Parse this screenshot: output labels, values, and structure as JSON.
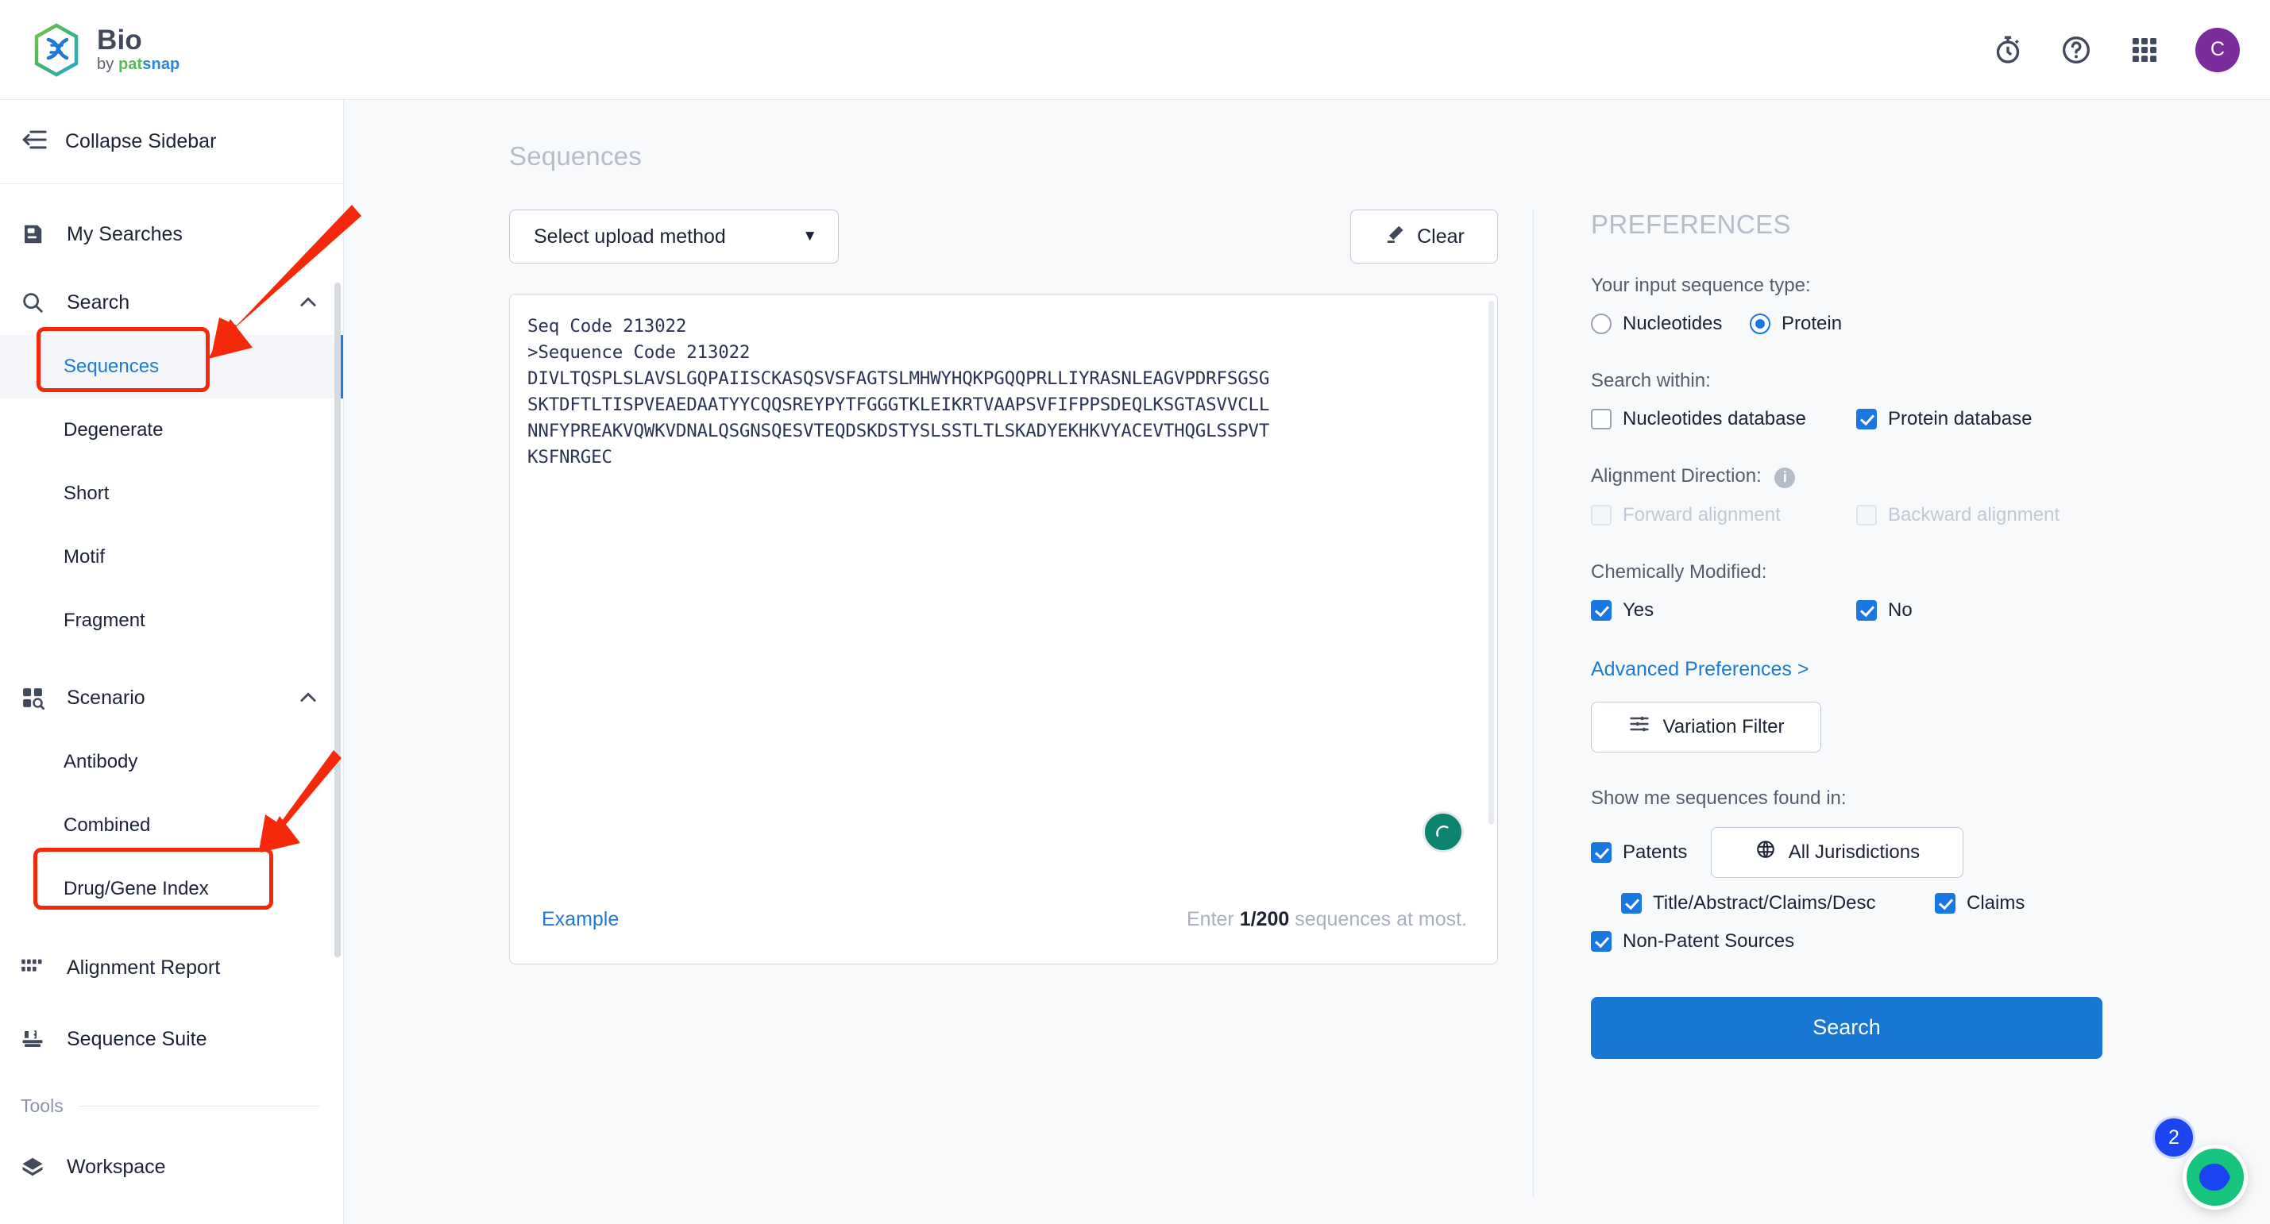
{
  "brand": {
    "title": "Bio",
    "by": "by ",
    "pat": "pat",
    "snap": "snap",
    "logo_icon": "dna-hexagon-logo"
  },
  "topbar": {
    "icons": [
      {
        "name": "stopwatch-icon",
        "label": "Stopwatch"
      },
      {
        "name": "help-icon",
        "label": "Help"
      },
      {
        "name": "apps-grid-icon",
        "label": "Apps"
      }
    ],
    "avatar_initial": "C"
  },
  "sidebar": {
    "collapse_label": "Collapse Sidebar",
    "collapse_icon": "collapse-sidebar-icon",
    "my_searches": {
      "label": "My Searches",
      "icon": "saved-searches-icon"
    },
    "search_group": {
      "label": "Search",
      "icon": "magnifier-icon",
      "chevron": "chevron-up-icon",
      "items": [
        {
          "label": "Sequences",
          "active": true
        },
        {
          "label": "Degenerate",
          "active": false
        },
        {
          "label": "Short",
          "active": false
        },
        {
          "label": "Motif",
          "active": false
        },
        {
          "label": "Fragment",
          "active": false
        }
      ]
    },
    "scenario_group": {
      "label": "Scenario",
      "icon": "scenario-grid-search-icon",
      "chevron": "chevron-up-icon",
      "items": [
        {
          "label": "Antibody",
          "active": false
        },
        {
          "label": "Combined",
          "active": false
        },
        {
          "label": "Drug/Gene Index",
          "active": false
        }
      ]
    },
    "alignment_report": {
      "label": "Alignment Report",
      "icon": "alignment-columns-icon"
    },
    "sequence_suite": {
      "label": "Sequence Suite",
      "icon": "toolbox-icon"
    },
    "tools_label": "Tools",
    "workspace": {
      "label": "Workspace",
      "icon": "workspace-cube-icon"
    }
  },
  "main": {
    "page_title": "Sequences",
    "upload_select": {
      "value": "Select upload method",
      "caret_icon": "caret-down-icon"
    },
    "clear_button": {
      "label": "Clear",
      "icon": "eraser-icon"
    },
    "sequence_text": "Seq Code 213022\n>Sequence Code 213022\nDIVLTQSPLSLAVSLGQPAIISCKASQSVSFAGTSLMHWYHQKPGQQPRLLIYRASNLEAGVPDRFSGSG\nSKTDFTLTISPVEAEDAATYYCQQSREYPYTFGGGTKLEIKRTVAAPSVFIFPPSDEQLKSGTASVVCLL\nNNFYPREAKVQWKVDNALQSGNSQESVTEQDSKDSTYSLSSTLTLSKADYEKHKVYACEVTHQGLSSPVT\nKSFNRGEC",
    "fab_icon": "sequence-helper-icon",
    "example_link": "Example",
    "counter_prefix": "Enter ",
    "counter_value": "1/200",
    "counter_suffix": " sequences at most."
  },
  "preferences": {
    "title": "PREFERENCES",
    "input_type_label": "Your input sequence type:",
    "input_types": [
      {
        "label": "Nucleotides",
        "selected": false
      },
      {
        "label": "Protein",
        "selected": true
      }
    ],
    "search_within_label": "Search within:",
    "search_within": [
      {
        "label": "Nucleotides database",
        "checked": false
      },
      {
        "label": "Protein database",
        "checked": true
      }
    ],
    "alignment_direction_label": "Alignment Direction:",
    "alignment_info_icon": "info-icon",
    "alignment_info_char": "i",
    "alignment_directions": [
      {
        "label": "Forward alignment",
        "checked": false,
        "disabled": true
      },
      {
        "label": "Backward alignment",
        "checked": false,
        "disabled": true
      }
    ],
    "chemically_modified_label": "Chemically Modified:",
    "chemically_modified": [
      {
        "label": "Yes",
        "checked": true
      },
      {
        "label": "No",
        "checked": true
      }
    ],
    "advanced_link": "Advanced Preferences >",
    "variation_filter": {
      "label": "Variation Filter",
      "icon": "sliders-icon"
    },
    "show_me_label": "Show me sequences found in:",
    "patents": {
      "label": "Patents",
      "checked": true
    },
    "jurisdictions": {
      "label": "All Jurisdictions",
      "icon": "globe-icon"
    },
    "patent_fields": [
      {
        "label": "Title/Abstract/Claims/Desc",
        "checked": true
      },
      {
        "label": "Claims",
        "checked": true
      }
    ],
    "non_patent": {
      "label": "Non-Patent Sources",
      "checked": true
    },
    "search_button": "Search"
  },
  "chat": {
    "badge_count": "2",
    "fab_icon": "chat-bubble-icon"
  },
  "colors": {
    "accent_blue": "#1877d2",
    "link_blue": "#1f7ad4",
    "annotation_red": "#f4290c",
    "avatar_purple": "#7b2d9e",
    "chat_green": "#17c47d"
  }
}
